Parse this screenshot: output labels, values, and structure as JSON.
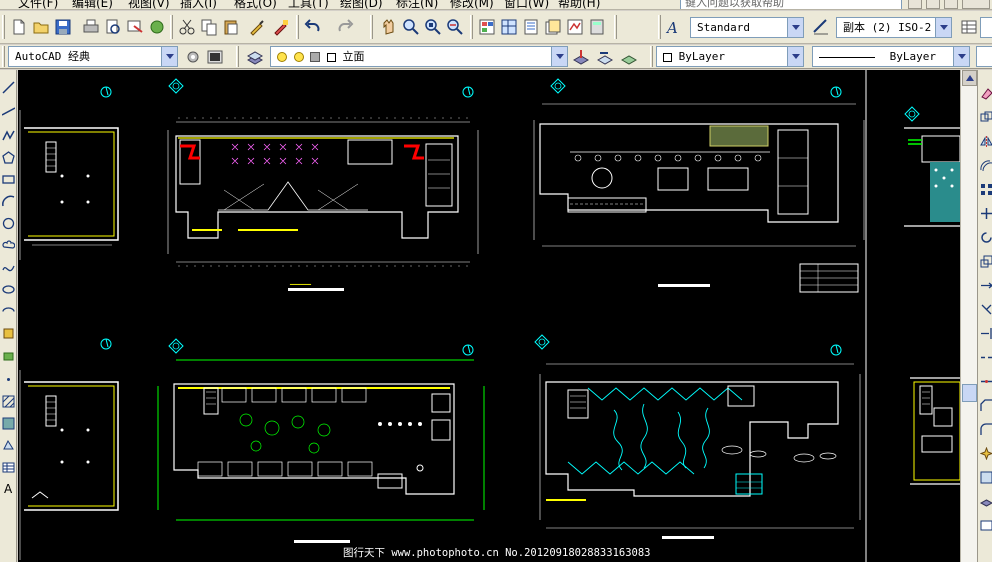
{
  "menu": {
    "items": [
      "文件(F)",
      "编辑(E)",
      "视图(V)",
      "插入(I)",
      "格式(O)",
      "工具(T)",
      "绘图(D)",
      "标注(N)",
      "修改(M)",
      "窗口(W)",
      "帮助(H)"
    ],
    "help_search_placeholder": "键入问题以获取帮助"
  },
  "toolbar": {
    "text_style": "Standard",
    "dim_style": "副本 (2) ISO-2",
    "workspace": "AutoCAD 经典",
    "layer": "立面",
    "color": "ByLayer",
    "linetype": "ByLayer"
  },
  "icons": {
    "new": "new-file-icon",
    "open": "open-folder-icon",
    "save": "save-icon",
    "print": "print-icon",
    "undo": "undo-icon",
    "redo": "redo-icon",
    "pan": "pan-icon",
    "zoom": "zoom-icon",
    "layers": "layers-icon",
    "bulb": "lightbulb-icon",
    "text_style": "text-style-icon",
    "dim_style": "dim-style-icon"
  },
  "colors": {
    "canvas_bg": "#000000",
    "cad_white": "#ffffff",
    "cad_yellow": "#ffff00",
    "cad_cyan": "#00ffff",
    "cad_green": "#00ff00",
    "cad_red": "#ff0000",
    "cad_magenta": "#ff66ff",
    "cad_teal_fill": "#2a8c8c"
  },
  "watermark": "图行天下 www.photophoto.cn No.20120918028833163083"
}
